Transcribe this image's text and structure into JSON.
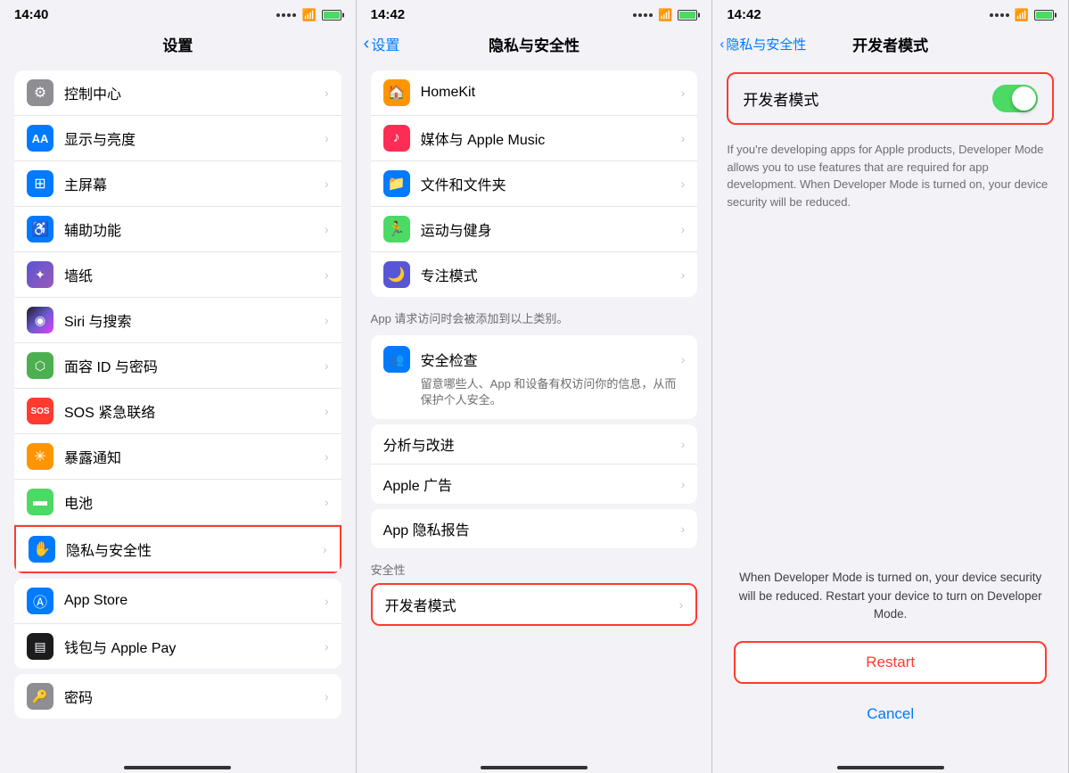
{
  "panel1": {
    "statusTime": "14:40",
    "title": "设置",
    "items": [
      {
        "id": "control",
        "icon": "⚙",
        "iconBg": "#8e8e93",
        "label": "控制中心",
        "highlighted": false
      },
      {
        "id": "display",
        "icon": "AA",
        "iconBg": "#007aff",
        "label": "显示与亮度",
        "highlighted": false
      },
      {
        "id": "home",
        "icon": "⊞",
        "iconBg": "#007aff",
        "label": "主屏幕",
        "highlighted": false
      },
      {
        "id": "accessibility",
        "icon": "♿",
        "iconBg": "#007aff",
        "label": "辅助功能",
        "highlighted": false
      },
      {
        "id": "wallpaper",
        "icon": "✦",
        "iconBg": "#5856d6",
        "label": "墙纸",
        "highlighted": false
      },
      {
        "id": "siri",
        "icon": "◉",
        "iconBg": "#1a1a2e",
        "label": "Siri 与搜索",
        "highlighted": false
      },
      {
        "id": "faceid",
        "icon": "⬡",
        "iconBg": "#4caf50",
        "label": "面容 ID 与密码",
        "highlighted": false
      },
      {
        "id": "sos",
        "icon": "SOS",
        "iconBg": "#ff3b30",
        "label": "SOS 紧急联络",
        "highlighted": false,
        "iconFont": "10px"
      },
      {
        "id": "exposure",
        "icon": "✳",
        "iconBg": "#ff9500",
        "label": "暴露通知",
        "highlighted": false
      },
      {
        "id": "battery",
        "icon": "▬",
        "iconBg": "#4cd964",
        "label": "电池",
        "highlighted": false
      },
      {
        "id": "privacy",
        "icon": "✋",
        "iconBg": "#007aff",
        "label": "隐私与安全性",
        "highlighted": true
      },
      {
        "id": "appstore",
        "icon": "A",
        "iconBg": "#007aff",
        "label": "App Store",
        "highlighted": false
      },
      {
        "id": "wallet",
        "icon": "▤",
        "iconBg": "#1c1c1e",
        "label": "钱包与 Apple Pay",
        "highlighted": false
      },
      {
        "id": "password",
        "icon": "🔑",
        "iconBg": "#8e8e93",
        "label": "密码",
        "highlighted": false
      }
    ]
  },
  "panel2": {
    "statusTime": "14:42",
    "title": "隐私与安全性",
    "backLabel": "设置",
    "items": [
      {
        "id": "homekit",
        "icon": "🏠",
        "iconBg": "#ff9500",
        "label": "HomeKit"
      },
      {
        "id": "music",
        "icon": "♪",
        "iconBg": "#ff2d55",
        "label": "媒体与 Apple Music"
      },
      {
        "id": "files",
        "icon": "📁",
        "iconBg": "#007aff",
        "label": "文件和文件夹"
      },
      {
        "id": "health",
        "icon": "🏃",
        "iconBg": "#4cd964",
        "label": "运动与健身"
      },
      {
        "id": "focus",
        "icon": "🌙",
        "iconBg": "#5856d6",
        "label": "专注模式"
      }
    ],
    "appNote": "App 请求访问时会被添加到以上类别。",
    "safetyCheck": {
      "label": "安全检查",
      "desc": "留意哪些人、App 和设备有权访问你的信息，从而保护个人安全。"
    },
    "analytics": {
      "label": "分析与改进"
    },
    "adLabel": {
      "label": "Apple 广告"
    },
    "privacy": {
      "label": "App 隐私报告"
    },
    "securitySection": "安全性",
    "developerMode": {
      "label": "开发者模式",
      "highlighted": true
    }
  },
  "panel3": {
    "statusTime": "14:42",
    "breadcrumbBack": "隐私与安全性",
    "title": "开发者模式",
    "developerMode": {
      "label": "开发者模式",
      "toggleOn": true,
      "description": "If you're developing apps for Apple products, Developer Mode allows you to use features that are required for app development. When Developer Mode is turned on, your device security will be reduced."
    },
    "dialog": {
      "text": "When Developer Mode is turned on, your device security will be reduced. Restart your device to turn on Developer Mode.",
      "restartLabel": "Restart",
      "cancelLabel": "Cancel"
    }
  }
}
